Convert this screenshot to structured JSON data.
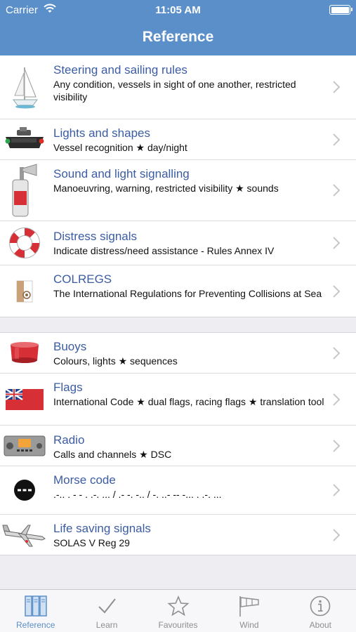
{
  "status_bar": {
    "carrier": "Carrier",
    "time": "11:05 AM"
  },
  "nav": {
    "title": "Reference"
  },
  "section1": [
    {
      "title": "Steering and sailing rules",
      "subtitle": "Any condition, vessels in sight of one another, restricted visibility",
      "icon": "sailboat-icon"
    },
    {
      "title": "Lights and shapes",
      "subtitle": "Vessel recognition ★ day/night",
      "icon": "vessel-lights-icon"
    },
    {
      "title": "Sound and light signalling",
      "subtitle": "Manoeuvring, warning, restricted visibility ★ sounds",
      "icon": "foghorn-icon"
    },
    {
      "title": "Distress signals",
      "subtitle": "Indicate distress/need assistance - Rules Annex IV",
      "icon": "lifebuoy-icon"
    },
    {
      "title": "COLREGS",
      "subtitle": "The International Regulations for Preventing Collisions at Sea",
      "icon": "colregs-book-icon"
    }
  ],
  "section2": [
    {
      "title": "Buoys",
      "subtitle": "Colours, lights ★ sequences",
      "icon": "buoy-icon"
    },
    {
      "title": "Flags",
      "subtitle": "International Code ★ dual flags, racing flags ★ translation tool",
      "icon": "red-ensign-flag-icon"
    },
    {
      "title": "Radio",
      "subtitle": "Calls and channels ★ DSC",
      "icon": "vhf-radio-icon"
    },
    {
      "title": "Morse code",
      "subtitle": ".-.. . - - . .-. ... / .- -. -.. / -. ..- -- -... . .-. ...",
      "icon": "morse-icon"
    },
    {
      "title": "Life saving signals",
      "subtitle": "SOLAS V Reg 29",
      "icon": "airplane-icon"
    }
  ],
  "tabs": [
    {
      "label": "Reference",
      "icon": "books-icon",
      "active": true
    },
    {
      "label": "Learn",
      "icon": "checkmark-icon",
      "active": false
    },
    {
      "label": "Favourites",
      "icon": "star-icon",
      "active": false
    },
    {
      "label": "Wind",
      "icon": "windsock-icon",
      "active": false
    },
    {
      "label": "About",
      "icon": "info-icon",
      "active": false
    }
  ],
  "colors": {
    "nav_bar": "#5b8fc9",
    "row_title": "#3b5ca3",
    "tab_active": "#5b8fc9",
    "tab_inactive": "#8e8e93"
  }
}
